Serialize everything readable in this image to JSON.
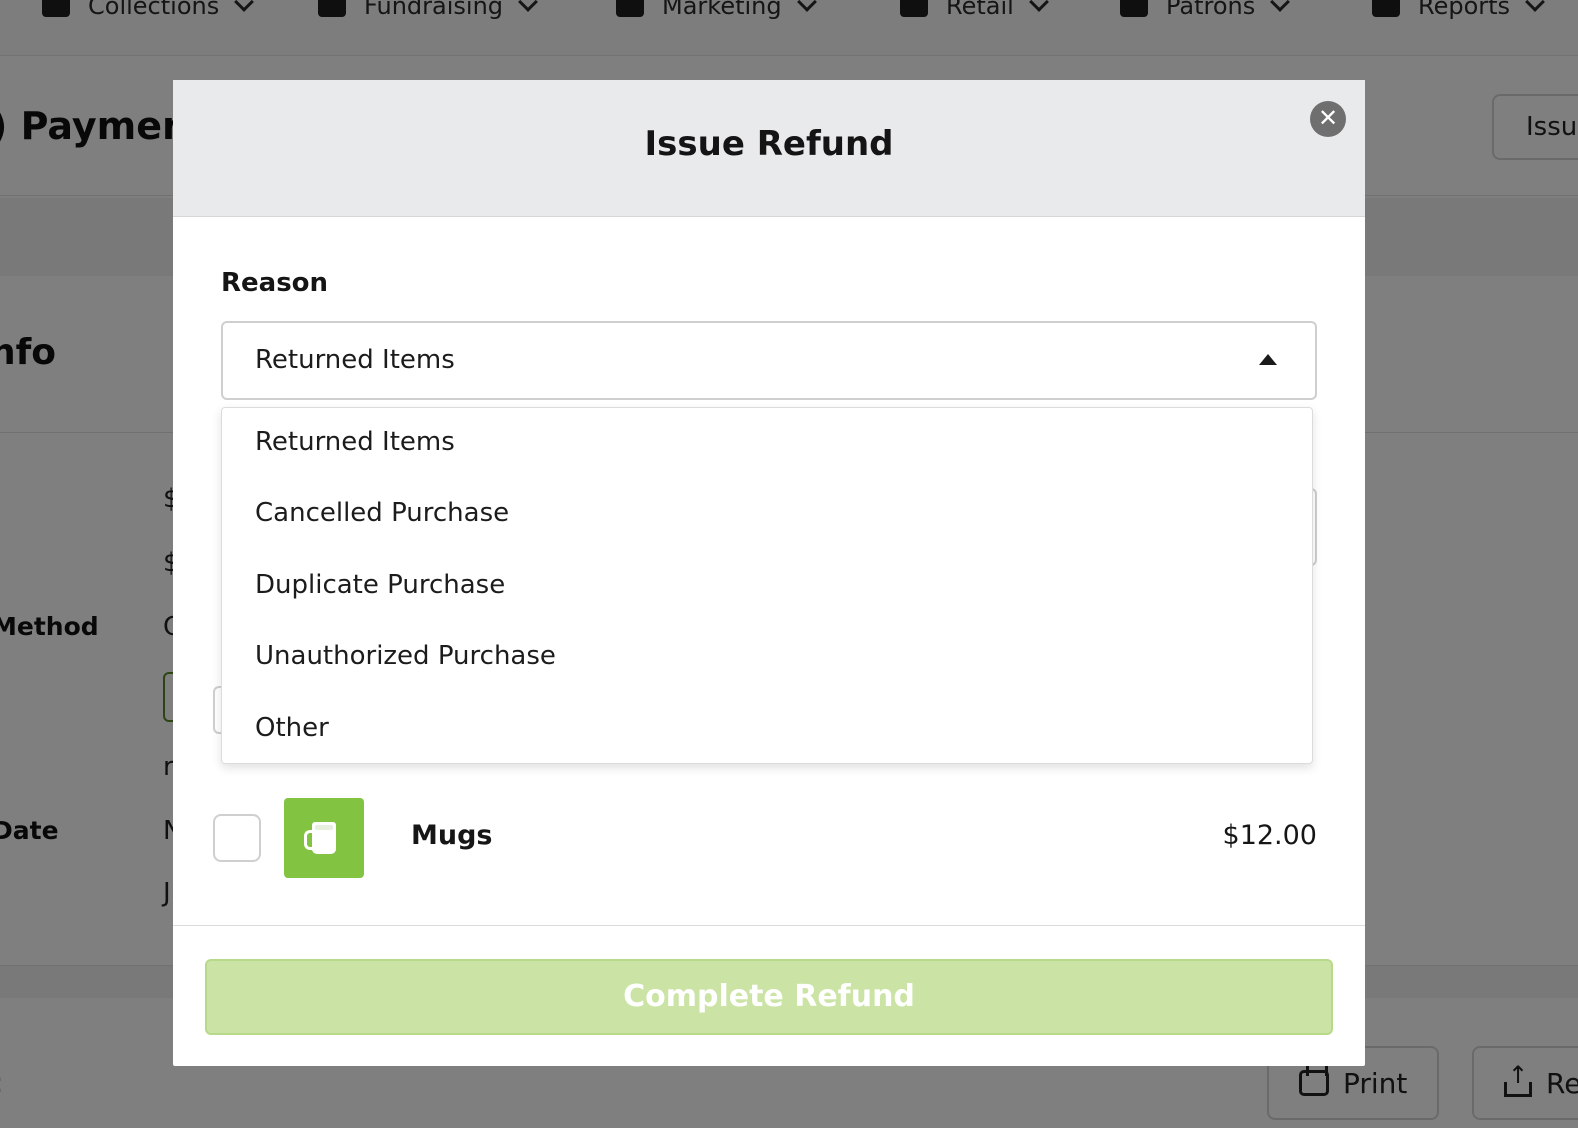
{
  "nav": {
    "items": [
      {
        "label": "Collections",
        "icon": "dollar-icon"
      },
      {
        "label": "Fundraising",
        "icon": "hand-heart-icon"
      },
      {
        "label": "Marketing",
        "icon": "mail-icon"
      },
      {
        "label": "Retail",
        "icon": "store-icon"
      },
      {
        "label": "Patrons",
        "icon": "people-icon"
      },
      {
        "label": "Reports",
        "icon": "pie-chart-icon"
      }
    ]
  },
  "background": {
    "page_title": ") Payment",
    "issue_button": "Issu",
    "section_title": "nfo",
    "labels": {
      "method": "Method",
      "date": "Date"
    },
    "values": {
      "v1": "$",
      "v2": "$",
      "v3": "C",
      "v4": "r",
      "v5": "N",
      "v6": "J"
    },
    "footer": {
      "left_glyph": ":",
      "print": "Print",
      "second": "Re"
    }
  },
  "modal": {
    "title": "Issue Refund",
    "close_symbol": "✕",
    "reason_label": "Reason",
    "selected_reason": "Returned Items",
    "options": [
      "Returned Items",
      "Cancelled Purchase",
      "Duplicate Purchase",
      "Unauthorized Purchase",
      "Other"
    ],
    "under_glyph": ")",
    "item": {
      "name": "Mugs",
      "price": "$12.00",
      "thumb_color": "#82c341"
    },
    "complete_button": "Complete Refund"
  }
}
